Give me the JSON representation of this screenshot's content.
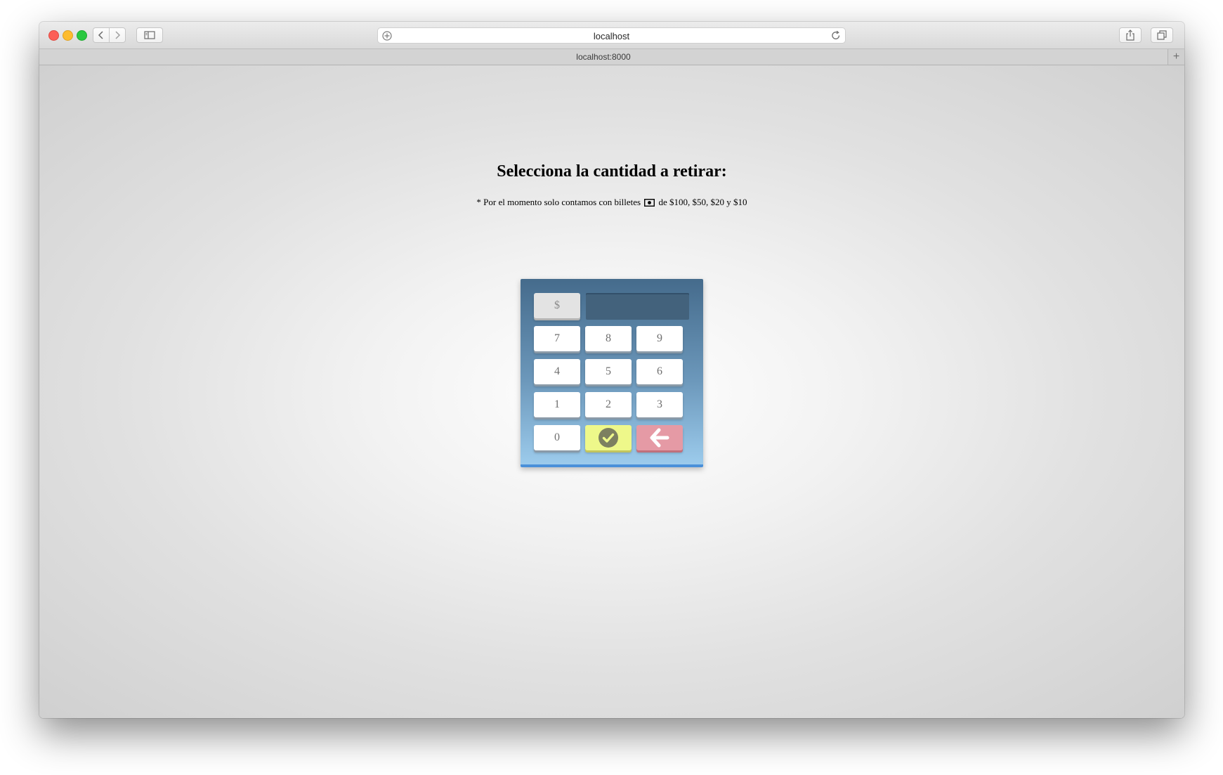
{
  "browser": {
    "address_url": "localhost",
    "tab_title": "localhost:8000",
    "new_tab_label": "+"
  },
  "page": {
    "heading": "Selecciona la cantidad a retirar:",
    "note_before_icon": "* Por el momento solo contamos con billetes",
    "note_icon": "money-bill-icon",
    "note_after_icon": "de $100, $50, $20 y $10"
  },
  "keypad": {
    "currency_label": "$",
    "display_value": "",
    "keys": {
      "k7": "7",
      "k8": "8",
      "k9": "9",
      "k4": "4",
      "k5": "5",
      "k6": "6",
      "k1": "1",
      "k2": "2",
      "k3": "3",
      "k0": "0"
    },
    "ok_icon": "check-circle-icon",
    "back_icon": "arrow-left-icon",
    "colors": {
      "panel_top": "#456b8c",
      "panel_bottom": "#9ccbec",
      "ok_key": "#eef88a",
      "back_key": "#e59aa5",
      "display": "#43627c"
    }
  }
}
